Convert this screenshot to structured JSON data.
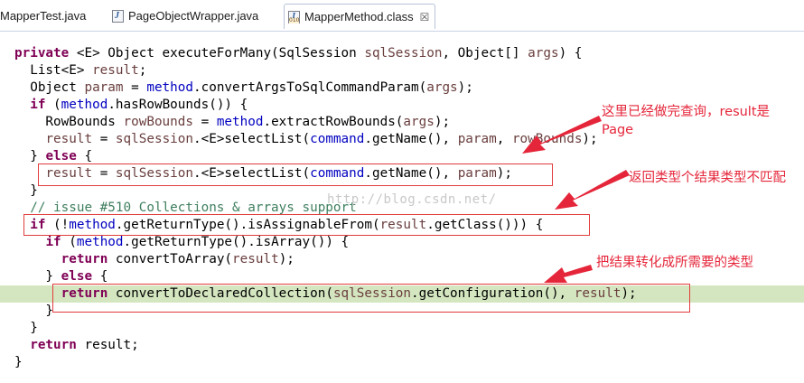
{
  "tabs": [
    {
      "label": "MapperTest.java",
      "icon": "java-file-icon"
    },
    {
      "label": "PageObjectWrapper.java",
      "icon": "java-file-icon"
    },
    {
      "label": "MapperMethod.class",
      "icon": "class-file-icon",
      "active": true,
      "close": "☒"
    }
  ],
  "code": {
    "l1": {
      "k": "private",
      "a": " <E> Object executeForMany(SqlSession ",
      "v1": "sqlSession",
      "b": ", Object[] ",
      "v2": "args",
      "c": ") {"
    },
    "l2": {
      "a": "  List<E> ",
      "v": "result",
      "b": ";"
    },
    "l3": {
      "a": "  Object ",
      "v1": "param",
      "b": " = ",
      "f": "method",
      "c": ".convertArgsToSqlCommandParam(",
      "v2": "args",
      "d": ");"
    },
    "l4": {
      "a": "  ",
      "k": "if",
      "b": " (",
      "f": "method",
      "c": ".hasRowBounds()) {"
    },
    "l5": {
      "a": "    RowBounds ",
      "v1": "rowBounds",
      "b": " = ",
      "f": "method",
      "c": ".extractRowBounds(",
      "v2": "args",
      "d": ");"
    },
    "l6": {
      "a": "    ",
      "v1": "result",
      "b": " = ",
      "v2": "sqlSession",
      "c": ".<E>selectList(",
      "f": "command",
      "d": ".getName(), ",
      "v3": "param",
      "e": ", ",
      "v4": "rowBounds",
      "g": ");"
    },
    "l7": {
      "a": "  } ",
      "k": "else",
      "b": " {"
    },
    "l8": {
      "a": "    ",
      "v1": "result",
      "b": " = ",
      "v2": "sqlSession",
      "c": ".<E>selectList(",
      "f": "command",
      "d": ".getName(), ",
      "v3": "param",
      "e": ");"
    },
    "l9": {
      "a": "  }"
    },
    "l10": {
      "a": "  ",
      "cm": "// issue #510 Collections & arrays support"
    },
    "l11": {
      "a": "  ",
      "k": "if",
      "b": " (!",
      "f": "method",
      "c": ".getReturnType().isAssignableFrom(",
      "v": "result",
      "d": ".getClass())) {"
    },
    "l12": {
      "a": "    ",
      "k": "if",
      "b": " (",
      "f": "method",
      "c": ".getReturnType().isArray()) {"
    },
    "l13": {
      "a": "      ",
      "k": "return",
      "b": " convertToArray(",
      "v": "result",
      "c": ");"
    },
    "l14": {
      "a": "    } ",
      "k": "else",
      "b": " {"
    },
    "l15": {
      "a": "      ",
      "k": "return",
      "b": " convertToDeclaredCollection(",
      "v1": "sqlSession",
      "c": ".getConfiguration(), ",
      "v2": "result",
      "d": ");"
    },
    "l16": {
      "a": "    }"
    },
    "l17": {
      "a": "  }"
    },
    "l18": {
      "a": "  ",
      "k": "return",
      "b": " result;"
    },
    "l19": {
      "a": "}"
    }
  },
  "annotations": {
    "note1_line1": "这里已经做完查询，result是",
    "note1_line2": "Page",
    "note2": "返回类型个结果类型不匹配",
    "note3": "把结果转化成所需要的类型"
  },
  "watermark": "http://blog.csdn.net/",
  "colors": {
    "keyword": "#7f0055",
    "field": "#0000c0",
    "local_var": "#6a3e3e",
    "comment": "#3f7f5f",
    "annotation_red": "#e5263a",
    "current_line": "#d4e6c0"
  }
}
